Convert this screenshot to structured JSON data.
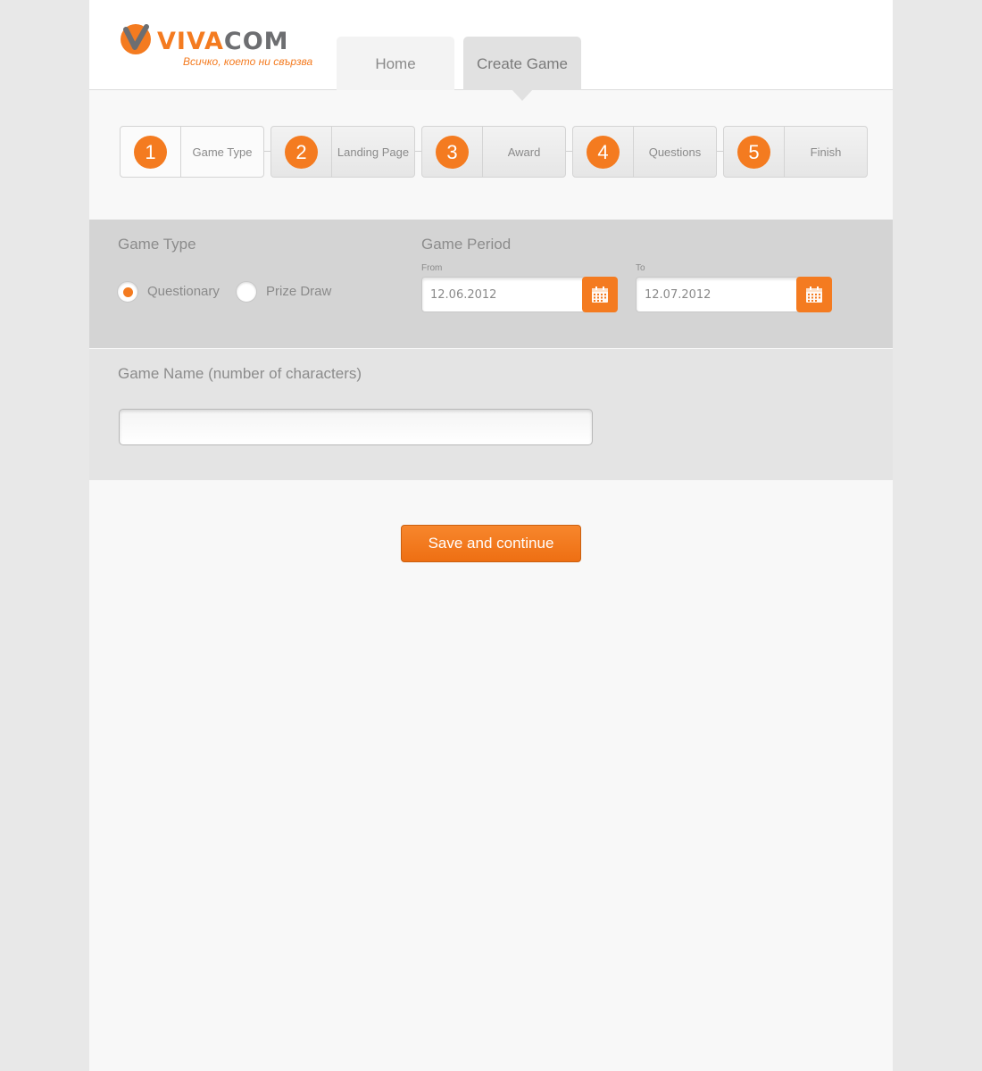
{
  "brand": {
    "name_part1": "VIVA",
    "name_part2": "COM",
    "tagline": "Всичко, което ни свързва",
    "accent_color": "#f47b20",
    "gray_color": "#6d6e71"
  },
  "nav": {
    "tabs": [
      {
        "label": "Home"
      },
      {
        "label": "Create Game"
      }
    ],
    "active_tab": "Create Game"
  },
  "steps": [
    {
      "number": "1",
      "label": "Game Type"
    },
    {
      "number": "2",
      "label": "Landing Page"
    },
    {
      "number": "3",
      "label": "Award"
    },
    {
      "number": "4",
      "label": "Questions"
    },
    {
      "number": "5",
      "label": "Finish"
    }
  ],
  "game_type": {
    "title": "Game Type",
    "options": [
      {
        "label": "Questionary",
        "checked": true
      },
      {
        "label": "Prize Draw",
        "checked": false
      }
    ]
  },
  "game_period": {
    "title": "Game Period",
    "from_label": "From",
    "from_value": "12.06.2012",
    "to_label": "To",
    "to_value": "12.07.2012",
    "icon": "calendar-icon"
  },
  "game_name": {
    "title": "Game Name (number of characters)",
    "value": ""
  },
  "actions": {
    "save_label": "Save and continue"
  }
}
